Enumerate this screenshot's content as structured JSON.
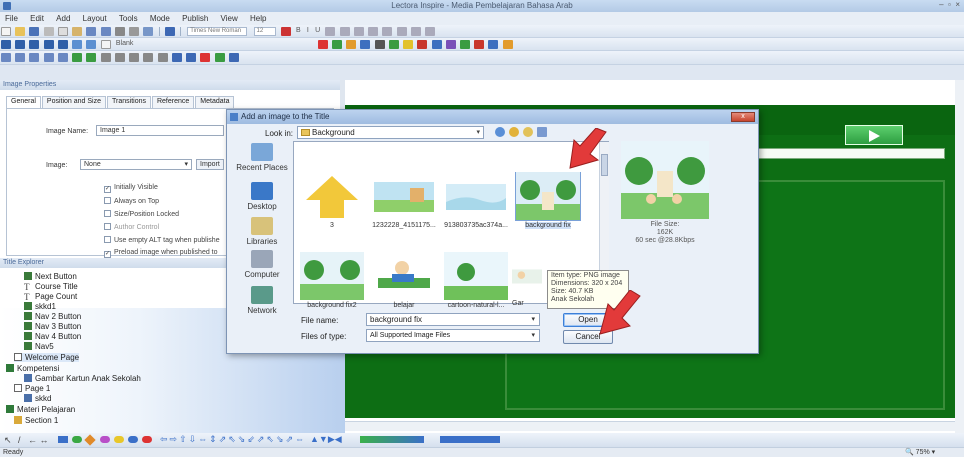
{
  "window": {
    "title": "Lectora Inspire - Media Pembelajaran Bahasa Arab"
  },
  "menu": [
    "File",
    "Edit",
    "Add",
    "Layout",
    "Tools",
    "Mode",
    "Publish",
    "View",
    "Help"
  ],
  "toolbar": {
    "font_name": "Times New Roman",
    "font_size": "12",
    "blank_label": "Blank"
  },
  "image_properties": {
    "panel_title": "Image Properties",
    "tabs": [
      "General",
      "Position and Size",
      "Transitions",
      "Reference",
      "Metadata"
    ],
    "image_name_label": "Image Name:",
    "image_name_value": "Image 1",
    "image_label": "Image:",
    "image_value": "None",
    "import_button": "Import",
    "checkboxes": [
      {
        "label": "Initially Visible",
        "checked": true
      },
      {
        "label": "Always on Top",
        "checked": false
      },
      {
        "label": "Size/Position Locked",
        "checked": false
      },
      {
        "label": "Author Control",
        "checked": false
      },
      {
        "label": "Use empty ALT tag when publishe",
        "checked": false
      },
      {
        "label": "Preload image when published to",
        "checked": true
      }
    ]
  },
  "title_explorer": {
    "panel_title": "Title Explorer",
    "items": [
      {
        "label": "Next Button",
        "icon": "button-icon",
        "level": 1
      },
      {
        "label": "Course Title",
        "icon": "text-icon",
        "level": 1
      },
      {
        "label": "Page Count",
        "icon": "text-icon",
        "level": 1
      },
      {
        "label": "skkd1",
        "icon": "button-icon",
        "level": 1
      },
      {
        "label": "Nav 2 Button",
        "icon": "button-icon",
        "level": 1
      },
      {
        "label": "Nav 3 Button",
        "icon": "button-icon",
        "level": 1
      },
      {
        "label": "Nav 4 Button",
        "icon": "button-icon",
        "level": 1
      },
      {
        "label": "Nav5",
        "icon": "button-icon",
        "level": 1
      },
      {
        "label": "Welcome Page",
        "icon": "page-icon",
        "level": 1
      },
      {
        "label": "Kompetensi",
        "icon": "chapter-icon",
        "level": 0
      },
      {
        "label": "Gambar Kartun Anak Sekolah",
        "icon": "image-icon",
        "level": 2
      },
      {
        "label": "Page 1",
        "icon": "page-icon",
        "level": 1
      },
      {
        "label": "skkd",
        "icon": "image-icon",
        "level": 2
      },
      {
        "label": "Materi Pelajaran",
        "icon": "chapter-icon",
        "level": 0
      },
      {
        "label": "Section 1",
        "icon": "section-icon",
        "level": 1
      }
    ]
  },
  "dialog": {
    "title": "Add an image to the Title",
    "look_in_label": "Look in:",
    "look_in_value": "Background",
    "close_label": "x",
    "places": [
      "Recent Places",
      "Desktop",
      "Libraries",
      "Computer",
      "Network"
    ],
    "files": [
      {
        "name": "3",
        "type": "folder"
      },
      {
        "name": "1232228_4151175...",
        "type": "image"
      },
      {
        "name": "913803735ac374a...",
        "type": "image"
      },
      {
        "name": "background fix",
        "type": "image",
        "selected": true
      },
      {
        "name": "background fix2",
        "type": "image"
      },
      {
        "name": "belajar",
        "type": "image"
      },
      {
        "name": "cartoon-natural-l...",
        "type": "image"
      },
      {
        "name": "Gar",
        "type": "image"
      }
    ],
    "tooltip": [
      "Item type: PNG image",
      "Dimensions: 320 x 204",
      "Size: 40.7 KB",
      "Anak Sekolah"
    ],
    "preview": [
      "File Size:",
      "162K",
      "60 sec @28.8Kbps"
    ],
    "file_name_label": "File name:",
    "file_name_value": "background fix",
    "file_type_label": "Files of type:",
    "file_type_value": "All Supported Image Files",
    "open_button": "Open",
    "cancel_button": "Cancel"
  },
  "status": {
    "ready": "Ready",
    "zoom": "75%"
  },
  "colors": {
    "stage_green": "#0d6e14",
    "arrow_red": "#e23a3a",
    "accent_blue": "#3f6fb5"
  }
}
